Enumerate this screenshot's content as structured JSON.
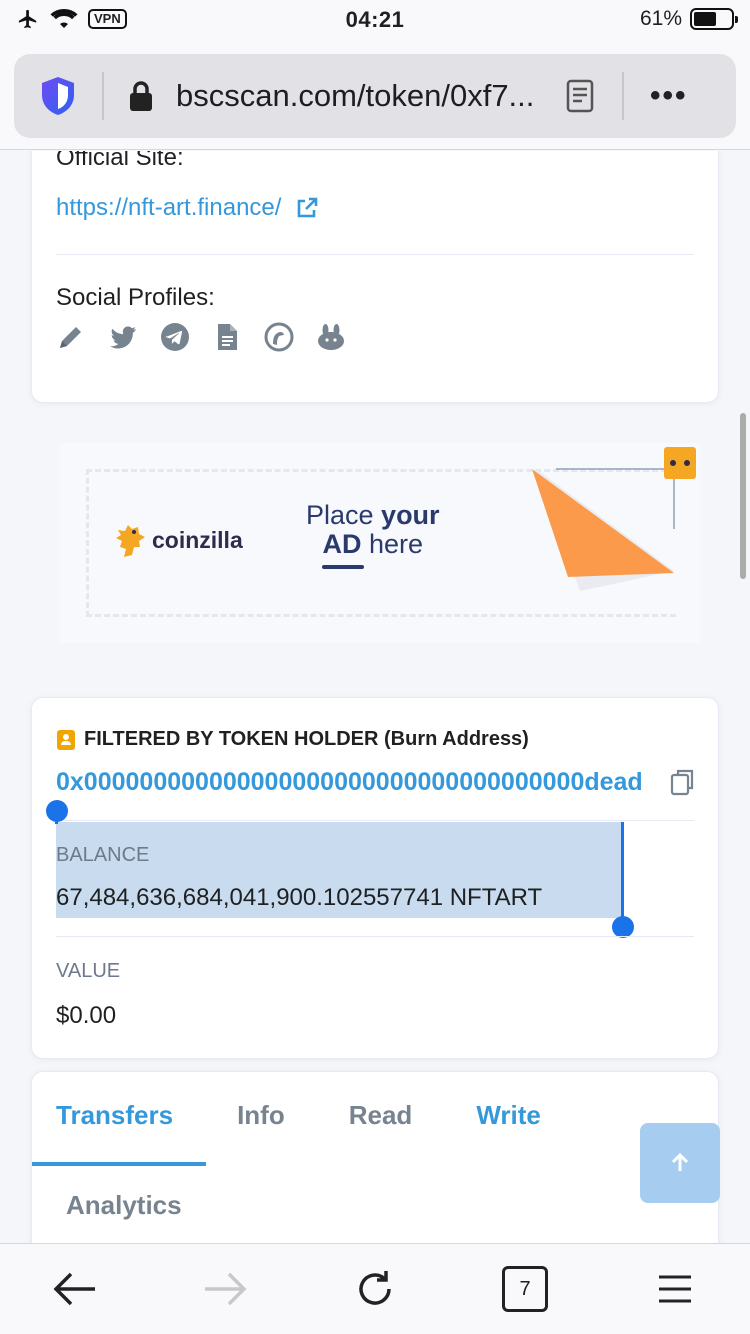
{
  "status_bar": {
    "time": "04:21",
    "vpn": "VPN",
    "battery": "61%"
  },
  "browser": {
    "url": "bscscan.com/token/0xf7...",
    "tab_count": "7"
  },
  "token_info": {
    "official_site_label": "Official Site:",
    "official_site_url": "https://nft-art.finance/",
    "social_label": "Social Profiles:",
    "social_icons": [
      "pencil-icon",
      "twitter-icon",
      "telegram-icon",
      "document-icon",
      "coingecko-icon",
      "pancakeswap-icon"
    ]
  },
  "ad": {
    "brand": "coinzilla",
    "line1_a": "Place ",
    "line1_b": "your",
    "line2_a": "AD",
    "line2_b": " here"
  },
  "holder": {
    "title": "FILTERED BY TOKEN HOLDER (Burn Address)",
    "address": "0x000000000000000000000000000000000000dead",
    "balance_label": "BALANCE",
    "balance": "67,484,636,684,041,900.102557741 NFTART",
    "value_label": "VALUE",
    "value": "$0.00"
  },
  "tabs": {
    "transfers": "Transfers",
    "info": "Info",
    "read": "Read",
    "write": "Write",
    "analytics": "Analytics"
  },
  "colors": {
    "accent": "#3498db",
    "selection": "#c9dbee",
    "handle": "#1a73e8"
  }
}
